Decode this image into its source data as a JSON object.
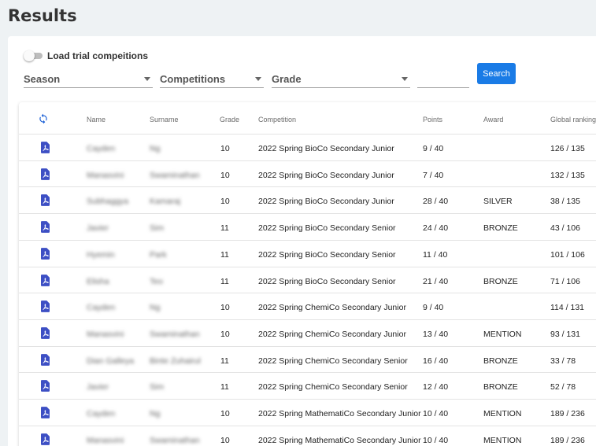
{
  "page": {
    "title": "Results"
  },
  "filters": {
    "toggle_label": "Load trial compeitions",
    "season_label": "Season",
    "competitions_label": "Competitions",
    "grade_label": "Grade",
    "text_value": "",
    "search_label": "Search"
  },
  "colors": {
    "accent": "#1a7be6",
    "pdf_icon": "#3d4fc4"
  },
  "table": {
    "headers": {
      "name": "Name",
      "surname": "Surname",
      "grade": "Grade",
      "competition": "Competition",
      "points": "Points",
      "award": "Award",
      "ranking": "Global ranking"
    },
    "rows": [
      {
        "name": "Cayden",
        "surname": "Ng",
        "grade": "10",
        "competition": "2022 Spring BioCo Secondary Junior",
        "points": "9 / 40",
        "award": "",
        "ranking": "126 / 135"
      },
      {
        "name": "Manasvini",
        "surname": "Swaminathan",
        "grade": "10",
        "competition": "2022 Spring BioCo Secondary Junior",
        "points": "7 / 40",
        "award": "",
        "ranking": "132 / 135"
      },
      {
        "name": "Subhaggya",
        "surname": "Kamaraj",
        "grade": "10",
        "competition": "2022 Spring BioCo Secondary Junior",
        "points": "28 / 40",
        "award": "SILVER",
        "ranking": "38 / 135"
      },
      {
        "name": "Javier",
        "surname": "Sim",
        "grade": "11",
        "competition": "2022 Spring BioCo Secondary Senior",
        "points": "24 / 40",
        "award": "BRONZE",
        "ranking": "43 / 106"
      },
      {
        "name": "Hyemin",
        "surname": "Park",
        "grade": "11",
        "competition": "2022 Spring BioCo Secondary Senior",
        "points": "11 / 40",
        "award": "",
        "ranking": "101 / 106"
      },
      {
        "name": "Elisha",
        "surname": "Teo",
        "grade": "11",
        "competition": "2022 Spring BioCo Secondary Senior",
        "points": "21 / 40",
        "award": "BRONZE",
        "ranking": "71 / 106"
      },
      {
        "name": "Cayden",
        "surname": "Ng",
        "grade": "10",
        "competition": "2022 Spring ChemiCo Secondary Junior",
        "points": "9 / 40",
        "award": "",
        "ranking": "114 / 131"
      },
      {
        "name": "Manasvini",
        "surname": "Swaminathan",
        "grade": "10",
        "competition": "2022 Spring ChemiCo Secondary Junior",
        "points": "13 / 40",
        "award": "MENTION",
        "ranking": "93 / 131"
      },
      {
        "name": "Dian Galleya",
        "surname": "Binte Zuhairul",
        "grade": "11",
        "competition": "2022 Spring ChemiCo Secondary Senior",
        "points": "16 / 40",
        "award": "BRONZE",
        "ranking": "33 / 78"
      },
      {
        "name": "Javier",
        "surname": "Sim",
        "grade": "11",
        "competition": "2022 Spring ChemiCo Secondary Senior",
        "points": "12 / 40",
        "award": "BRONZE",
        "ranking": "52 / 78"
      },
      {
        "name": "Cayden",
        "surname": "Ng",
        "grade": "10",
        "competition": "2022 Spring MathematiCo Secondary Junior",
        "points": "10 / 40",
        "award": "MENTION",
        "ranking": "189 / 236"
      },
      {
        "name": "Manasvini",
        "surname": "Swaminathan",
        "grade": "10",
        "competition": "2022 Spring MathematiCo Secondary Junior",
        "points": "10 / 40",
        "award": "MENTION",
        "ranking": "189 / 236"
      }
    ]
  }
}
